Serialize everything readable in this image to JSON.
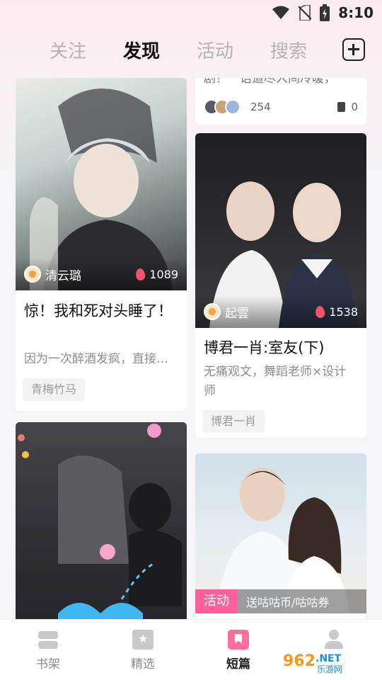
{
  "status_bar": {
    "time": "8:10"
  },
  "tabs": [
    {
      "label": "关注",
      "active": false
    },
    {
      "label": "发现",
      "active": true
    },
    {
      "label": "活动",
      "active": false
    },
    {
      "label": "搜索",
      "active": false
    }
  ],
  "feed": {
    "top_right_card": {
      "snippet": "剧！一语道尽人间冷暖，",
      "likes": "254",
      "books": "0"
    },
    "card1": {
      "author": "清云璐",
      "heat": "1089",
      "title": "惊！我和死对头睡了！",
      "desc": "因为一次醉酒发疯，直接…",
      "tag": "青梅竹马"
    },
    "card2": {
      "author": "起雲",
      "heat": "1538",
      "title": "博君一肖:室友(下)",
      "desc": "无痛观文，舞蹈老师×设计师",
      "tag": "博君一肖"
    },
    "card4": {
      "activity_badge": "活动",
      "activity_text": "送咕咕币/咕咕券"
    }
  },
  "bottom_nav": [
    {
      "label": "书架",
      "icon": "bookshelf-icon",
      "active": false
    },
    {
      "label": "精选",
      "icon": "featured-icon",
      "active": false
    },
    {
      "label": "短篇",
      "icon": "short-story-icon",
      "active": true
    },
    {
      "label": "我的",
      "icon": "profile-icon",
      "active": false
    }
  ],
  "watermark": "962.NET 乐游网",
  "colors": {
    "accent": "#ff5f9b",
    "heat": "#f3536a",
    "active_text": "#111111",
    "inactive_text": "#b7b2b6"
  }
}
